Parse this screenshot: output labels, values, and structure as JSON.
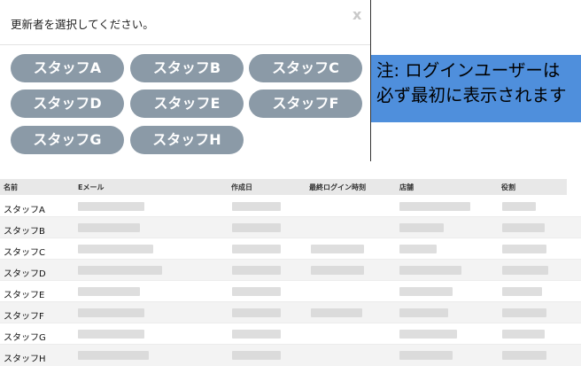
{
  "modal": {
    "title": "更新者を選択してください。",
    "close_label": "x",
    "staff_buttons": [
      "スタッフA",
      "スタッフB",
      "スタッフC",
      "スタッフD",
      "スタッフE",
      "スタッフF",
      "スタッフG",
      "スタッフH"
    ]
  },
  "note": {
    "line1": "注: ログインユーザーは",
    "line2": "必ず最初に表示されます"
  },
  "table": {
    "headers": [
      "名前",
      "Eメール",
      "作成日",
      "最終ログイン時刻",
      "店舗",
      "役割"
    ],
    "rows": [
      "スタッフA",
      "スタッフB",
      "スタッフC",
      "スタッフD",
      "スタッフE",
      "スタッフF",
      "スタッフG",
      "スタッフH"
    ]
  },
  "colors": {
    "button_bg": "#8b9aa7",
    "note_bg": "#4f8fdc"
  }
}
